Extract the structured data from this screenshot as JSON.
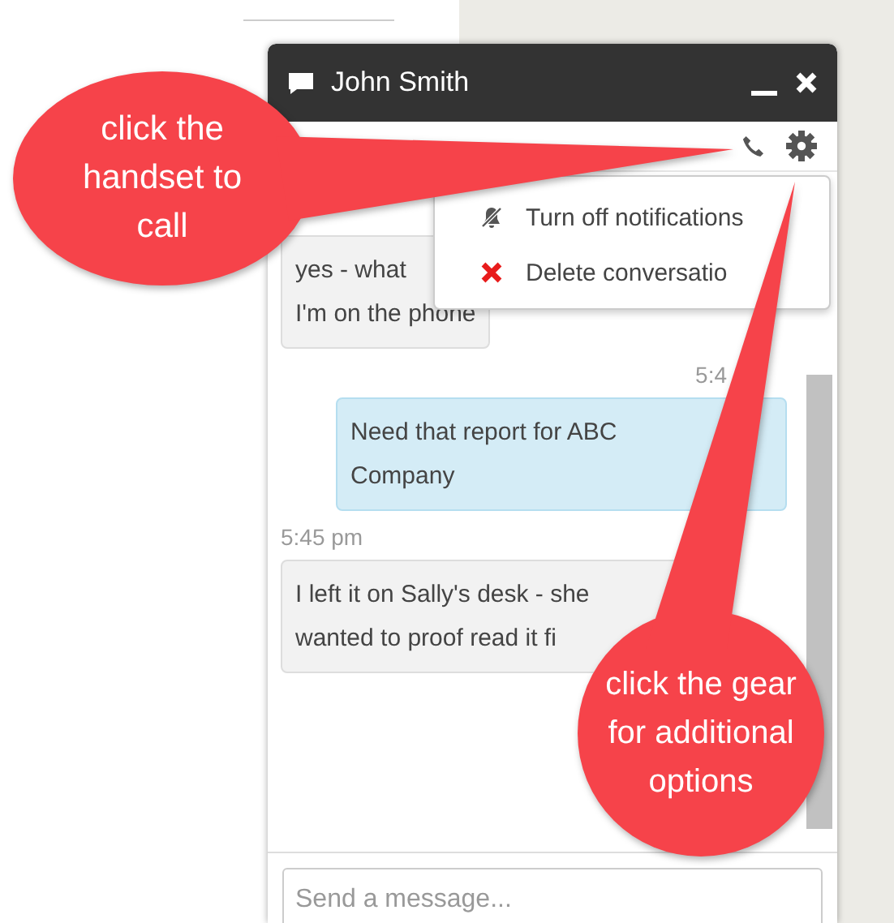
{
  "chat": {
    "title": "John Smith",
    "messages": [
      {
        "kind": "received",
        "lines": [
          "yes - what",
          "I'm on the phone"
        ]
      },
      {
        "kind": "sent",
        "time": "5:4",
        "lines": [
          "Need that report for ABC",
          "Company"
        ]
      },
      {
        "kind": "received",
        "time": "5:45 pm",
        "lines": [
          "I left it on Sally's desk - she",
          "wanted to proof read it fi"
        ]
      }
    ],
    "input": {
      "placeholder": "Send a message..."
    },
    "menu": [
      {
        "kind": "mute",
        "label": "Turn off notifications"
      },
      {
        "kind": "delete",
        "label": "Delete conversatio"
      }
    ]
  },
  "callouts": [
    {
      "text": "click the handset to call"
    },
    {
      "text": "click the gear for additional options"
    }
  ]
}
